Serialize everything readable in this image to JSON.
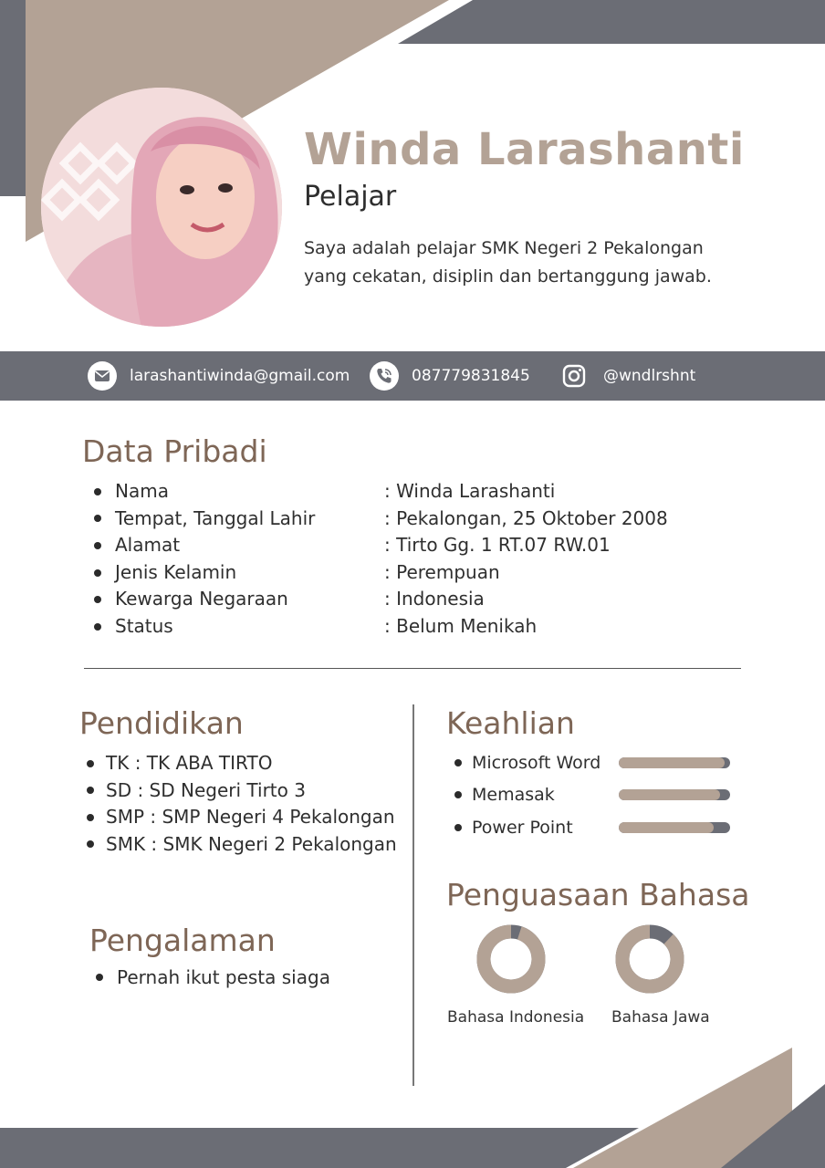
{
  "profile": {
    "name": "Winda Larashanti",
    "role": "Pelajar",
    "bio": "Saya adalah pelajar SMK Negeri 2 Pekalongan yang cekatan, disiplin dan bertanggung jawab.",
    "photo_alt": "profile photo"
  },
  "contact": {
    "email": "larashantiwinda@gmail.com",
    "phone": "087779831845",
    "instagram": "@wndlrshnt",
    "icons": [
      "mail-icon",
      "phone-icon",
      "instagram-icon"
    ]
  },
  "personal": {
    "title": "Data Pribadi",
    "rows": [
      {
        "label": "Nama",
        "value": ": Winda Larashanti"
      },
      {
        "label": "Tempat, Tanggal Lahir",
        "value": ": Pekalongan, 25 Oktober 2008"
      },
      {
        "label": "Alamat",
        "value": ": Tirto Gg. 1 RT.07 RW.01"
      },
      {
        "label": "Jenis Kelamin",
        "value": ": Perempuan"
      },
      {
        "label": "Kewarga Negaraan",
        "value": ": Indonesia"
      },
      {
        "label": "Status",
        "value": ": Belum Menikah"
      }
    ]
  },
  "education": {
    "title": "Pendidikan",
    "items": [
      "TK : TK ABA TIRTO",
      "SD : SD Negeri Tirto 3",
      "SMP : SMP Negeri 4 Pekalongan",
      "SMK : SMK Negeri 2 Pekalongan"
    ]
  },
  "experience": {
    "title": "Pengalaman",
    "items": [
      "Pernah ikut pesta siaga"
    ]
  },
  "skills": {
    "title": "Keahlian",
    "items": [
      {
        "name": "Microsoft Word",
        "level": 0.95
      },
      {
        "name": "Memasak",
        "level": 0.91
      },
      {
        "name": "Power Point",
        "level": 0.85
      }
    ]
  },
  "languages": {
    "title": "Penguasaan Bahasa",
    "items": [
      {
        "name": "Bahasa Indonesia",
        "level": 0.95
      },
      {
        "name": "Bahasa Jawa",
        "level": 0.88
      }
    ]
  },
  "colors": {
    "accent_taupe": "#b3a295",
    "slate": "#6b6d75",
    "heading_brown": "#7e6656",
    "background": "#ffffff"
  }
}
